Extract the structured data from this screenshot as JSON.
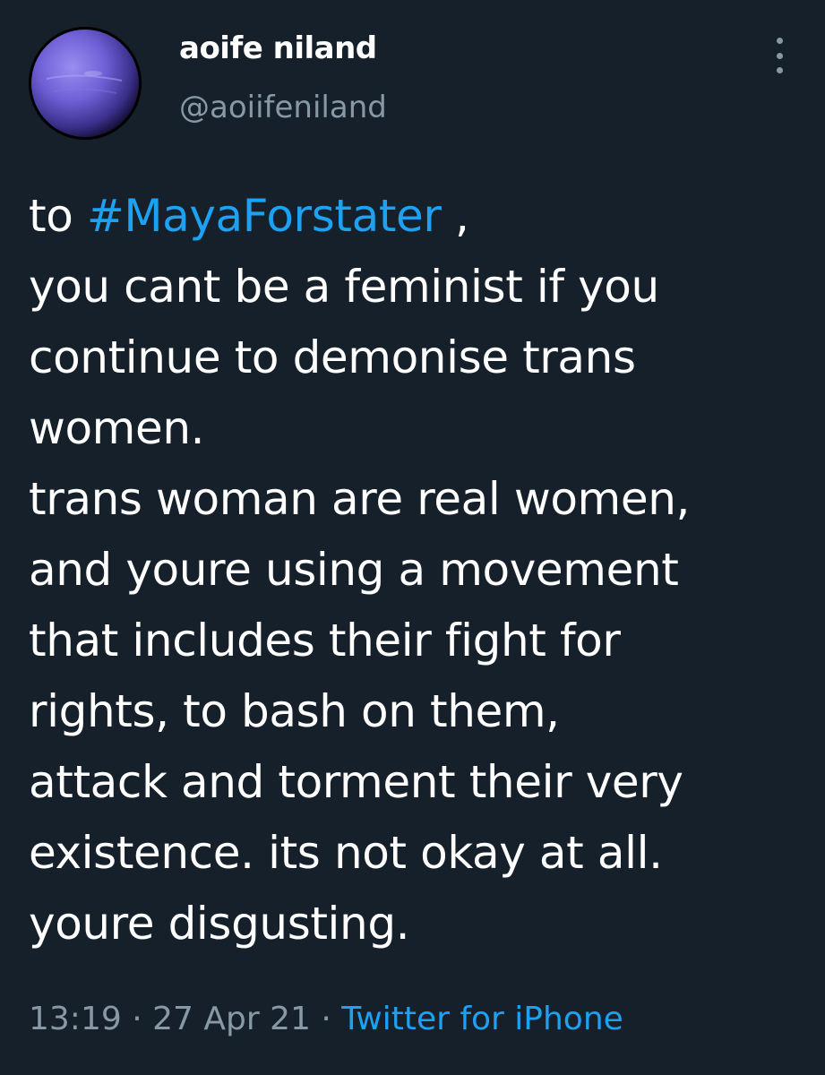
{
  "user": {
    "display_name": "aoife niland",
    "handle": "@aoiifeniland"
  },
  "tweet": {
    "line1": {
      "prefix": "to ",
      "hashtag": "#MayaForstater",
      "suffix": " ,"
    },
    "lines": [
      "you cant be a feminist if you",
      "continue to demonise trans",
      "women.",
      "trans woman are real women,",
      "and youre using a movement",
      "that includes their fight for",
      "rights, to bash on them,",
      "attack and torment their very",
      "existence. its not okay at all.",
      "youre disgusting."
    ]
  },
  "meta": {
    "time": "13:19",
    "separator": " · ",
    "date": "27 Apr 21",
    "source": "Twitter for iPhone"
  },
  "icons": {
    "more": "more-vertical-icon"
  },
  "colors": {
    "background": "#16202b",
    "text": "#ffffff",
    "secondary": "#8899a6",
    "accent": "#1da1f2"
  }
}
